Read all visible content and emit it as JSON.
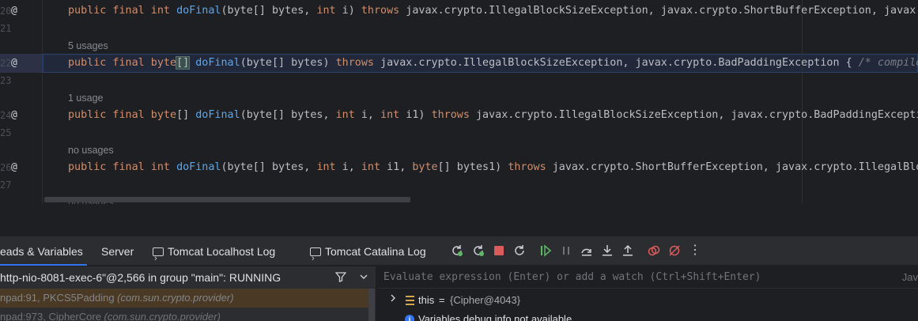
{
  "editor": {
    "line_numbers": [
      "20",
      "21",
      "22",
      "23",
      "24",
      "25",
      "26",
      "27"
    ],
    "usage_hints": [
      "5 usages",
      "1 usage",
      "no usages",
      "no usages"
    ],
    "lines": [
      {
        "kw": "public final int ",
        "fn": "doFinal",
        "a1": "(byte[] bytes, ",
        "kw2": "int",
        "a2": " i) ",
        "kw3": "throws",
        "rest": " javax.crypto.IllegalBlockSizeException, javax.crypto.ShortBufferException, javax.c"
      },
      {
        "kw": "public final byte",
        "brackets": "[]",
        "fn": " doFinal",
        "a1": "(byte[] bytes) ",
        "kw3": "throws",
        "rest": " javax.crypto.IllegalBlockSizeException, javax.crypto.BadPaddingException { ",
        "comment": "/* compiled"
      },
      {
        "kw": "public final byte",
        "mid": "[] ",
        "fn": "doFinal",
        "a1": "(byte[] bytes, ",
        "kw2": "int",
        "a2": " i, ",
        "kw4": "int",
        "a3": " i1) ",
        "kw3": "throws",
        "rest": " javax.crypto.IllegalBlockSizeException, javax.crypto.BadPaddingExceptio"
      },
      {
        "kw": "public final int ",
        "fn": "doFinal",
        "a1": "(byte[] bytes, ",
        "kw2": "int",
        "a2": " i, ",
        "kw4": "int",
        "a3": " i1, ",
        "kw5": "byte",
        "a4": "[] bytes1) ",
        "kw3": "throws",
        "rest": " javax.crypto.ShortBufferException, javax.crypto.IllegalBloc"
      }
    ]
  },
  "debug": {
    "tabs": [
      {
        "label": "eads & Variables",
        "active": true
      },
      {
        "label": "Server",
        "active": false
      },
      {
        "label": "Tomcat Localhost Log",
        "active": false
      },
      {
        "label": "Tomcat Catalina Log",
        "active": false
      }
    ],
    "thread_selector": "http-nio-8081-exec-6\"@2,566 in group \"main\": RUNNING",
    "frames": [
      {
        "method": "npad:91, PKCS5Padding ",
        "pkg": "(com.sun.crypto.provider)",
        "selected": true
      },
      {
        "method": "npad:973, CipherCore ",
        "pkg": "(com.sun.crypto.provider)",
        "selected": false
      }
    ],
    "evaluate_placeholder": "Evaluate expression (Enter) or add a watch (Ctrl+Shift+Enter)",
    "evaluate_lang": "Jav",
    "variables": [
      {
        "name": "this",
        "eq": " = ",
        "value": "{Cipher@4043}"
      },
      {
        "name": "Variables debug info not available"
      }
    ]
  },
  "colors": {
    "accent": "#3574f0",
    "keyword": "#cf8e6d",
    "function": "#56a8f5",
    "selected_frame": "#4a3a25",
    "resume_green": "#5fb865",
    "stop_red": "#db5c5c"
  }
}
